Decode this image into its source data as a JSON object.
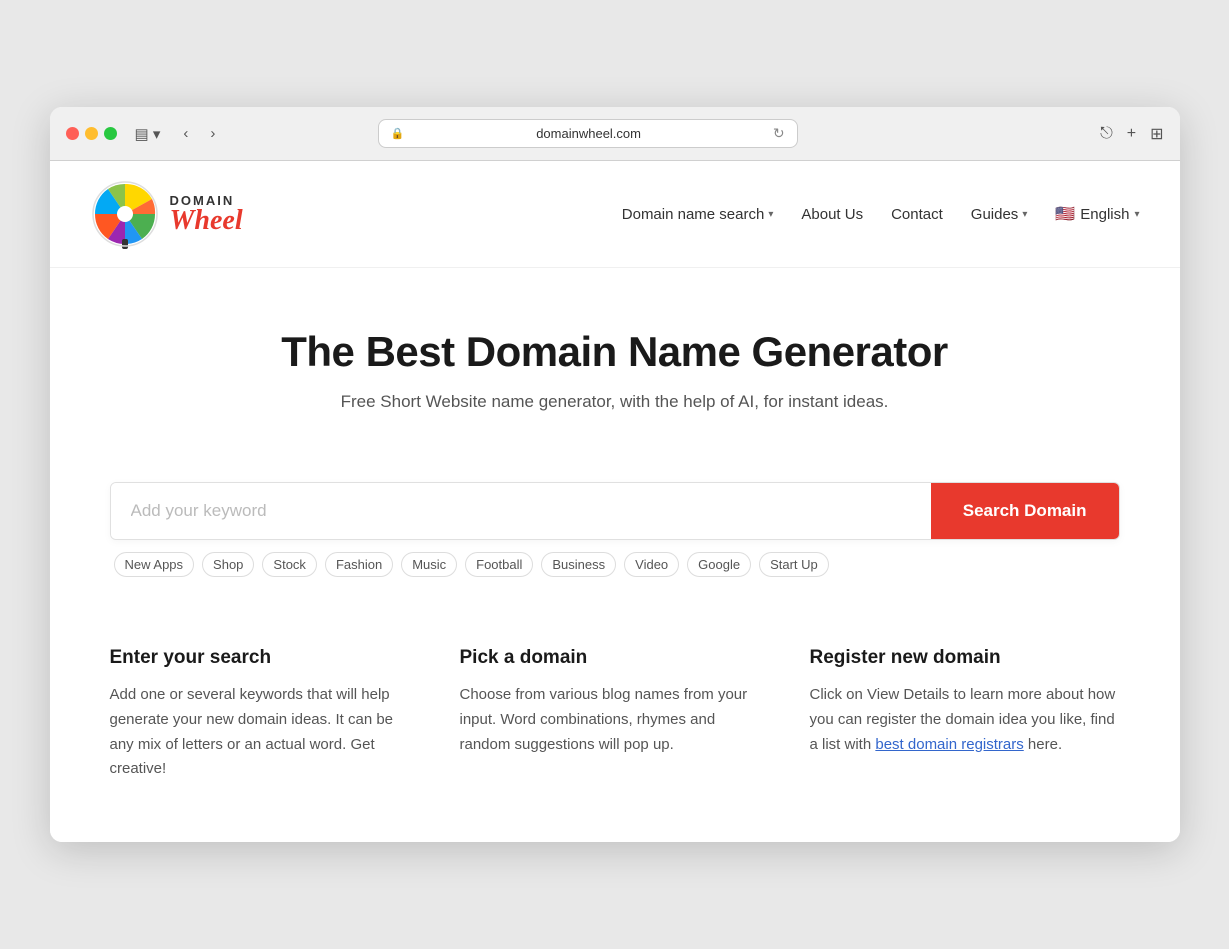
{
  "browser": {
    "url": "domainwheel.com",
    "traffic_lights": [
      "red",
      "yellow",
      "green"
    ]
  },
  "nav": {
    "logo_domain": "DOMAIN",
    "logo_wheel": "Wheel",
    "links": [
      {
        "label": "Domain name search",
        "has_dropdown": true
      },
      {
        "label": "About Us",
        "has_dropdown": false
      },
      {
        "label": "Contact",
        "has_dropdown": false
      },
      {
        "label": "Guides",
        "has_dropdown": true
      }
    ],
    "language": {
      "flag": "🇺🇸",
      "label": "English",
      "has_dropdown": true
    }
  },
  "hero": {
    "title": "The Best Domain Name Generator",
    "subtitle": "Free Short Website name generator, with the help of AI, for instant ideas."
  },
  "search": {
    "placeholder": "Add your keyword",
    "button_label": "Search Domain",
    "tags": [
      "New Apps",
      "Shop",
      "Stock",
      "Fashion",
      "Music",
      "Football",
      "Business",
      "Video",
      "Google",
      "Start Up"
    ]
  },
  "steps": [
    {
      "title": "Enter your search",
      "description": "Add one or several keywords that will help generate your new domain ideas. It can be any mix of letters or an actual word. Get creative!"
    },
    {
      "title": "Pick a domain",
      "description": "Choose from various blog names from your input. Word combinations, rhymes and random suggestions will pop up."
    },
    {
      "title": "Register new domain",
      "description_prefix": "Click on View Details to learn more about how you can register the domain idea you like, find a list with ",
      "link_text": "best domain registrars",
      "description_suffix": " here."
    }
  ],
  "icons": {
    "lock": "🔒",
    "reload": "↻",
    "share": "⎋",
    "new_tab": "+",
    "grid": "⊞",
    "back": "‹",
    "forward": "›",
    "sidebar": "▤",
    "shield": "⚑"
  }
}
